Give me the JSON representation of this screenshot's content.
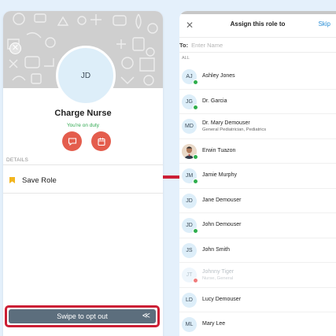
{
  "role_card": {
    "initials": "JD",
    "title": "Charge Nurse",
    "status": "You're on duty",
    "section_label": "DETAILS",
    "save_role_label": "Save Role",
    "swipe_label": "Swipe to opt out",
    "swipe_icon": "≪"
  },
  "assign_panel": {
    "title": "Assign this role to",
    "skip_label": "Skip",
    "close_glyph": "✕",
    "to_label": "To:",
    "to_placeholder": "Enter Name",
    "section_label": "ALL"
  },
  "contacts": [
    {
      "initials": "AJ",
      "name": "Ashley Jones",
      "subtitle": "",
      "presence": "online"
    },
    {
      "initials": "JG",
      "name": "Dr. Garcia",
      "subtitle": "",
      "presence": "online"
    },
    {
      "initials": "MD",
      "name": "Dr. Mary Demouser",
      "subtitle": "General Pediatrician, Pediatrics",
      "presence": "none"
    },
    {
      "initials": "",
      "name": "Erwin Tuazon",
      "subtitle": "",
      "presence": "online",
      "photo": true
    },
    {
      "initials": "JM",
      "name": "Jamie Murphy",
      "subtitle": "",
      "presence": "online"
    },
    {
      "initials": "JD",
      "name": "Jane Demouser",
      "subtitle": "",
      "presence": "none"
    },
    {
      "initials": "JD",
      "name": "John Demouser",
      "subtitle": "",
      "presence": "online"
    },
    {
      "initials": "JS",
      "name": "John Smith",
      "subtitle": "",
      "presence": "none"
    },
    {
      "initials": "JT",
      "name": "Johnny Tiger",
      "subtitle": "Nurse, General",
      "presence": "dnd",
      "unavailable": true
    },
    {
      "initials": "LD",
      "name": "Lucy Demouser",
      "subtitle": "",
      "presence": "none"
    },
    {
      "initials": "ML",
      "name": "Mary Lee",
      "subtitle": "",
      "presence": "none"
    }
  ],
  "colors": {
    "accent_red": "#e45d4d",
    "highlight_red": "#cc1f35",
    "online_green": "#2eae4c",
    "link_blue": "#2b8fd6",
    "swipe_bar": "#5c6e7d"
  }
}
